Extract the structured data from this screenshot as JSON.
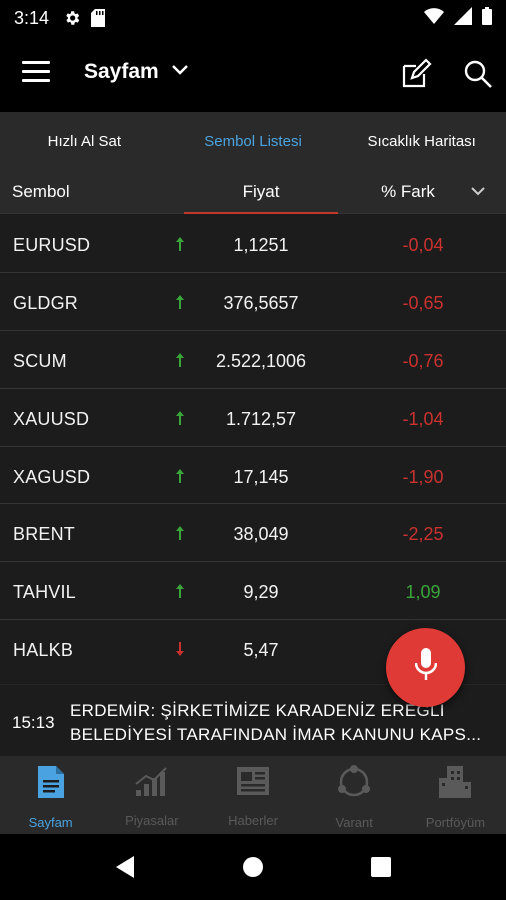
{
  "status_bar": {
    "time": "3:14",
    "icons": [
      "gear-icon",
      "sd-card-icon",
      "wifi-icon",
      "signal-icon",
      "battery-icon"
    ]
  },
  "app_bar": {
    "title": "Sayfam",
    "icons": [
      "menu-icon",
      "chevron-down-icon",
      "edit-icon",
      "search-icon"
    ]
  },
  "tabs": [
    {
      "label": "Hızlı Al Sat",
      "active": false
    },
    {
      "label": "Sembol Listesi",
      "active": true
    },
    {
      "label": "Sıcaklık Haritası",
      "active": false
    }
  ],
  "columns": {
    "symbol": "Sembol",
    "price": "Fiyat",
    "diff": "% Fark"
  },
  "rows": [
    {
      "symbol": "EURUSD",
      "direction": "up",
      "price": "1,1251",
      "diff": "-0,04"
    },
    {
      "symbol": "GLDGR",
      "direction": "up",
      "price": "376,5657",
      "diff": "-0,65"
    },
    {
      "symbol": "SCUM",
      "direction": "up",
      "price": "2.522,1006",
      "diff": "-0,76"
    },
    {
      "symbol": "XAUUSD",
      "direction": "up",
      "price": "1.712,57",
      "diff": "-1,04"
    },
    {
      "symbol": "XAGUSD",
      "direction": "up",
      "price": "17,145",
      "diff": "-1,90"
    },
    {
      "symbol": "BRENT",
      "direction": "up",
      "price": "38,049",
      "diff": "-2,25"
    },
    {
      "symbol": "TAHVIL",
      "direction": "up",
      "price": "9,29",
      "diff": "1,09"
    },
    {
      "symbol": "HALKB",
      "direction": "down",
      "price": "5,47",
      "diff": ""
    }
  ],
  "news": {
    "time": "15:13",
    "line1": "ERDEMİR:  ŞİRKETİMİZE KARADENİZ EREĞLİ",
    "line2": "BELEDİYESİ TARAFINDAN İMAR KANUNU KAPS..."
  },
  "bottom_nav": [
    {
      "label": "Sayfam",
      "icon": "document-icon",
      "active": true
    },
    {
      "label": "Piyasalar",
      "icon": "bar-chart-icon",
      "active": false
    },
    {
      "label": "Haberler",
      "icon": "newspaper-icon",
      "active": false
    },
    {
      "label": "Varant",
      "icon": "network-icon",
      "active": false
    },
    {
      "label": "Portföyüm",
      "icon": "buildings-icon",
      "active": false
    }
  ],
  "colors": {
    "accent": "#4aa3e0",
    "positive": "#3aa63a",
    "negative": "#c9322f",
    "fab": "#e03a36"
  }
}
